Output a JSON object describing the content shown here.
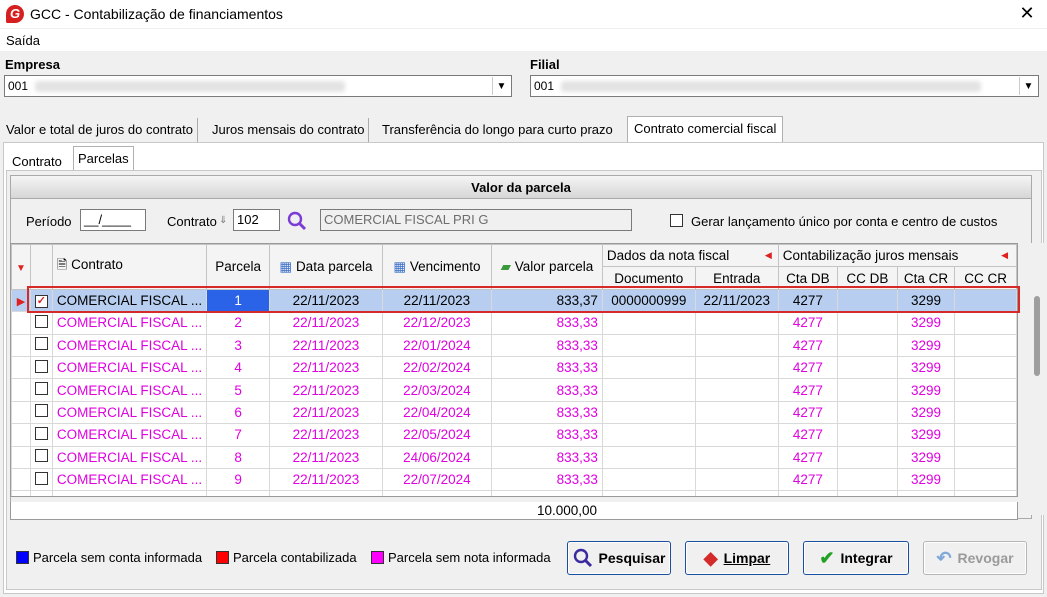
{
  "window": {
    "title": "GCC - Contabilização de financiamentos",
    "close_glyph": "✕",
    "logo_letter": "G"
  },
  "menu": {
    "items": [
      "Saída"
    ]
  },
  "empresa": {
    "label": "Empresa",
    "value": "001"
  },
  "filial": {
    "label": "Filial",
    "value": "001"
  },
  "main_tabs": [
    "Valor e total de juros do contrato",
    "Juros mensais do contrato",
    "Transferência do longo para curto prazo",
    "Contrato comercial fiscal"
  ],
  "sub_tabs": [
    "Contrato",
    "Parcelas"
  ],
  "section": {
    "title": "Valor da parcela"
  },
  "filters": {
    "periodo_label": "Período",
    "periodo_value": "__/____",
    "contrato_label": "Contrato",
    "contrato_value": "102",
    "contrato_desc": "COMERCIAL FISCAL PRI G",
    "gerar_label": "Gerar lançamento único por conta e centro de custos"
  },
  "grid": {
    "group_headers": {
      "nota": "Dados da nota fiscal",
      "juros": "Contabilização juros mensais"
    },
    "columns": {
      "contrato": "Contrato",
      "parcela": "Parcela",
      "data_parcela": "Data parcela",
      "vencimento": "Vencimento",
      "valor_parcela": "Valor parcela",
      "documento": "Documento",
      "entrada": "Entrada",
      "cta_db": "Cta DB",
      "cc_db": "CC DB",
      "cta_cr": "Cta CR",
      "cc_cr": "CC CR"
    },
    "rows": [
      {
        "checked": true,
        "contrato": "COMERCIAL FISCAL ...",
        "parcela": "1",
        "data_parcela": "22/11/2023",
        "vencimento": "22/11/2023",
        "valor": "833,37",
        "documento": "0000000999",
        "entrada": "22/11/2023",
        "cta_db": "4277",
        "cc_db": "",
        "cta_cr": "3299",
        "cc_cr": ""
      },
      {
        "checked": false,
        "contrato": "COMERCIAL FISCAL ...",
        "parcela": "2",
        "data_parcela": "22/11/2023",
        "vencimento": "22/12/2023",
        "valor": "833,33",
        "documento": "",
        "entrada": "",
        "cta_db": "4277",
        "cc_db": "",
        "cta_cr": "3299",
        "cc_cr": ""
      },
      {
        "checked": false,
        "contrato": "COMERCIAL FISCAL ...",
        "parcela": "3",
        "data_parcela": "22/11/2023",
        "vencimento": "22/01/2024",
        "valor": "833,33",
        "documento": "",
        "entrada": "",
        "cta_db": "4277",
        "cc_db": "",
        "cta_cr": "3299",
        "cc_cr": ""
      },
      {
        "checked": false,
        "contrato": "COMERCIAL FISCAL ...",
        "parcela": "4",
        "data_parcela": "22/11/2023",
        "vencimento": "22/02/2024",
        "valor": "833,33",
        "documento": "",
        "entrada": "",
        "cta_db": "4277",
        "cc_db": "",
        "cta_cr": "3299",
        "cc_cr": ""
      },
      {
        "checked": false,
        "contrato": "COMERCIAL FISCAL ...",
        "parcela": "5",
        "data_parcela": "22/11/2023",
        "vencimento": "22/03/2024",
        "valor": "833,33",
        "documento": "",
        "entrada": "",
        "cta_db": "4277",
        "cc_db": "",
        "cta_cr": "3299",
        "cc_cr": ""
      },
      {
        "checked": false,
        "contrato": "COMERCIAL FISCAL ...",
        "parcela": "6",
        "data_parcela": "22/11/2023",
        "vencimento": "22/04/2024",
        "valor": "833,33",
        "documento": "",
        "entrada": "",
        "cta_db": "4277",
        "cc_db": "",
        "cta_cr": "3299",
        "cc_cr": ""
      },
      {
        "checked": false,
        "contrato": "COMERCIAL FISCAL ...",
        "parcela": "7",
        "data_parcela": "22/11/2023",
        "vencimento": "22/05/2024",
        "valor": "833,33",
        "documento": "",
        "entrada": "",
        "cta_db": "4277",
        "cc_db": "",
        "cta_cr": "3299",
        "cc_cr": ""
      },
      {
        "checked": false,
        "contrato": "COMERCIAL FISCAL ...",
        "parcela": "8",
        "data_parcela": "22/11/2023",
        "vencimento": "24/06/2024",
        "valor": "833,33",
        "documento": "",
        "entrada": "",
        "cta_db": "4277",
        "cc_db": "",
        "cta_cr": "3299",
        "cc_cr": ""
      },
      {
        "checked": false,
        "contrato": "COMERCIAL FISCAL ...",
        "parcela": "9",
        "data_parcela": "22/11/2023",
        "vencimento": "22/07/2024",
        "valor": "833,33",
        "documento": "",
        "entrada": "",
        "cta_db": "4277",
        "cc_db": "",
        "cta_cr": "3299",
        "cc_cr": ""
      }
    ],
    "total": "10.000,00"
  },
  "legend": [
    {
      "label": "Parcela sem conta informada",
      "color": "#0000ff"
    },
    {
      "label": "Parcela contabilizada",
      "color": "#ff0000"
    },
    {
      "label": "Parcela sem nota informada",
      "color": "#ff00ff"
    }
  ],
  "buttons": {
    "pesquisar": "Pesquisar",
    "limpar": "Limpar",
    "integrar": "Integrar",
    "revogar": "Revogar"
  },
  "colors": {
    "magenta_text": "#e000e0",
    "selected_row": "#b8cef0",
    "selected_cell": "#2b63e8",
    "highlight_border": "#d42a2a"
  }
}
